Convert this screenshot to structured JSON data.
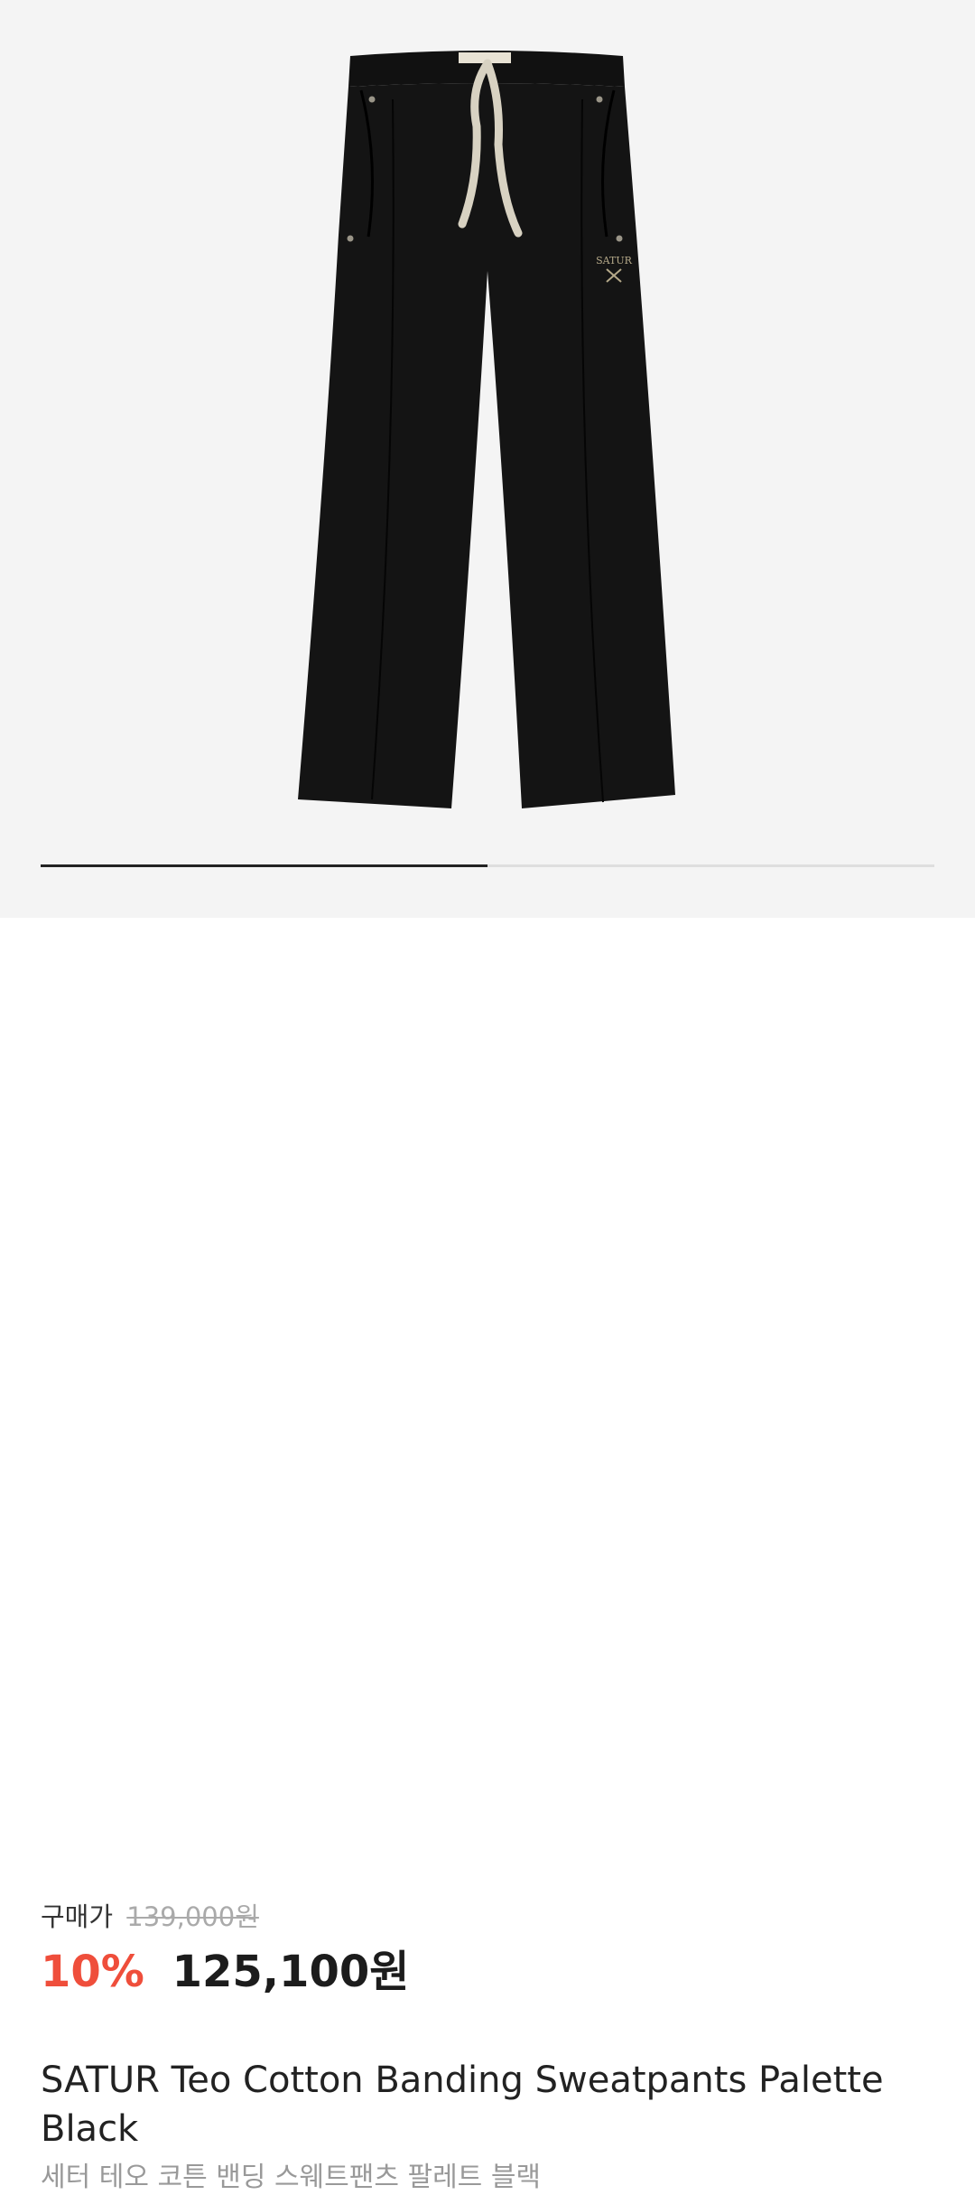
{
  "gallery": {
    "image_name": "black-sweatpants-product-photo",
    "logo_text": "SATUR",
    "progress": 0.5
  },
  "price": {
    "purchase_label": "구매가",
    "original_price": "139,000원",
    "discount_rate": "10%",
    "sale_price": "125,100원"
  },
  "product": {
    "name_en": "SATUR Teo Cotton Banding Sweatpants Palette Black",
    "name_ko": "세터 테오 코튼 밴딩 스웨트팬츠 팔레트 블랙"
  },
  "colors": {
    "discount": "#ef4e3b",
    "background_gallery": "#f4f4f4",
    "pants": "#141414",
    "drawstring": "#d8d2c2"
  }
}
